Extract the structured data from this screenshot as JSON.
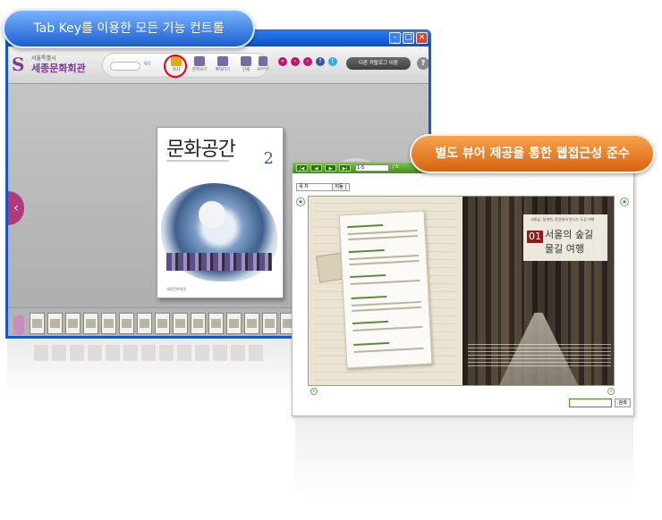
{
  "callouts": {
    "tab_key": "Tab Key를 이용한 모든 기능 컨트롤",
    "separate_viewer": "별도 뷰어 제공을 통한 웹접근성 준수"
  },
  "main_viewer": {
    "logo": {
      "small": "서울특별시",
      "big": "세종문화회관"
    },
    "page_total": "60",
    "toolbar": [
      {
        "label": "목차",
        "icon": "book-icon"
      },
      {
        "label": "한쪽보기",
        "icon": "grid-icon"
      },
      {
        "label": "확대하기",
        "icon": "zoom-icon"
      },
      {
        "label": "인쇄",
        "icon": "print-icon"
      },
      {
        "label": "슬라이드",
        "icon": "slide-icon"
      }
    ],
    "catalog_button": "다른 카탈로그 이동",
    "help": "?",
    "cover": {
      "title": "문화공간",
      "number": "2",
      "footer": "세종문화회관"
    },
    "search_label": "검색"
  },
  "accessible_viewer": {
    "page_value": "1-5",
    "page_total": "/ 5",
    "select_value": "목 차",
    "select_button": "이동",
    "article": {
      "number": "01",
      "title_line1": "서울의 숲길",
      "title_line2": "물길 여행",
      "kicker": "서울숲, 청계천, 한강에서 만나는 도심 여행"
    },
    "search_button": "검색"
  },
  "colors": {
    "brand_purple": "#a14a8d",
    "callout_blue": "#1b5ed1",
    "callout_orange": "#d7630d",
    "viewer_green": "#3d8f1d",
    "highlight_red": "#e3001b"
  }
}
